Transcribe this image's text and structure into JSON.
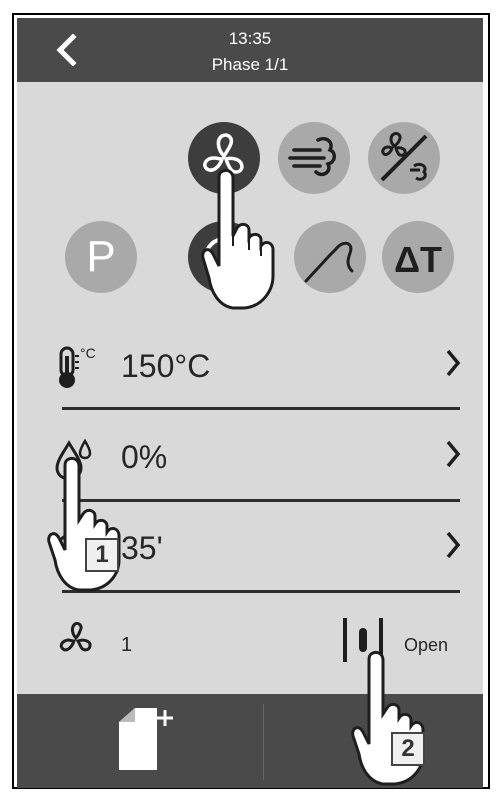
{
  "header": {
    "time": "13:35",
    "phase": "Phase 1/1"
  },
  "modes": {
    "top": [
      {
        "name": "fan",
        "icon": "fan-icon",
        "active": true
      },
      {
        "name": "steam",
        "icon": "steam-icon",
        "active": false
      },
      {
        "name": "fan-off",
        "icon": "fan-off-icon",
        "active": false
      }
    ],
    "bottom": [
      {
        "name": "program",
        "label": "P",
        "active": false
      },
      {
        "name": "timer",
        "icon": "timer-icon",
        "active": true
      },
      {
        "name": "core-probe",
        "icon": "probe-icon",
        "active": false
      },
      {
        "name": "delta-t",
        "label": "ΔT",
        "active": false
      }
    ]
  },
  "settings": {
    "temperature": {
      "unit_badge": "°C",
      "value": "150°C"
    },
    "humidity": {
      "value": "0%"
    },
    "time": {
      "value": "35'"
    }
  },
  "fan": {
    "speed": "1"
  },
  "vent": {
    "label": "Open"
  },
  "instructions": {
    "callout_1": "1",
    "callout_2": "2"
  },
  "colors": {
    "screen_bg": "#d9d9d9",
    "header_bg": "#4a4a4a",
    "active_button": "#3d3d3d",
    "inactive_button": "#a9a9a9"
  }
}
